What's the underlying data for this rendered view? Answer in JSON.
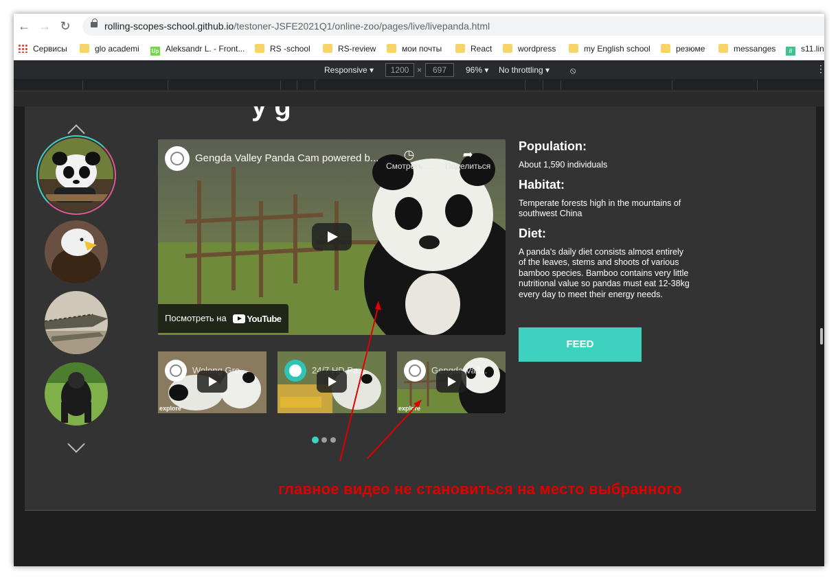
{
  "browser": {
    "url_host": "rolling-scopes-school.github.io",
    "url_path": "/testoner-JSFE2021Q1/online-zoo/pages/live/livepanda.html",
    "bookmarks": [
      "Сервисы",
      "glo academi",
      "Aleksandr L. - Front...",
      "RS -school",
      "RS-review",
      "мои почты",
      "React",
      "wordpress",
      "my English school",
      "резюме",
      "messanges",
      "s11.lin"
    ]
  },
  "device_toolbar": {
    "mode": "Responsive",
    "width": "1200",
    "height": "697",
    "zoom": "96%",
    "throttling": "No throttling"
  },
  "animals": [
    "panda",
    "eagle",
    "alligator",
    "gorilla"
  ],
  "main_video": {
    "title": "Gengda Valley Panda Cam powered b...",
    "watch_later": "Смотреть ...",
    "share": "Поделиться",
    "watch_on": "Посмотреть на",
    "youtube": "YouTube"
  },
  "thumbnails": [
    {
      "title": "Wolong Gro...",
      "watermark": "explore"
    },
    {
      "title": "24/7 HD Pa...",
      "watermark": ""
    },
    {
      "title": "Gengda Vall...",
      "watermark": "explore"
    }
  ],
  "info": {
    "population_title": "Population:",
    "population_text": "About 1,590 individuals",
    "habitat_title": "Habitat:",
    "habitat_text": "Temperate forests high in the mountains of southwest China",
    "diet_title": "Diet:",
    "diet_text": "A panda's daily diet consists almost entirely of the leaves, stems and shoots of various bamboo species. Bamboo contains very little nutritional value so pandas must eat 12-38kg every day to meet their energy needs."
  },
  "feed_label": "FEED",
  "carousel": {
    "pages": 3,
    "active": 1
  },
  "annotation": "главное видео не становиться на место выбранного",
  "colors": {
    "accent": "#3fd1c0",
    "annotation": "#e00000",
    "page_bg": "#333333"
  }
}
